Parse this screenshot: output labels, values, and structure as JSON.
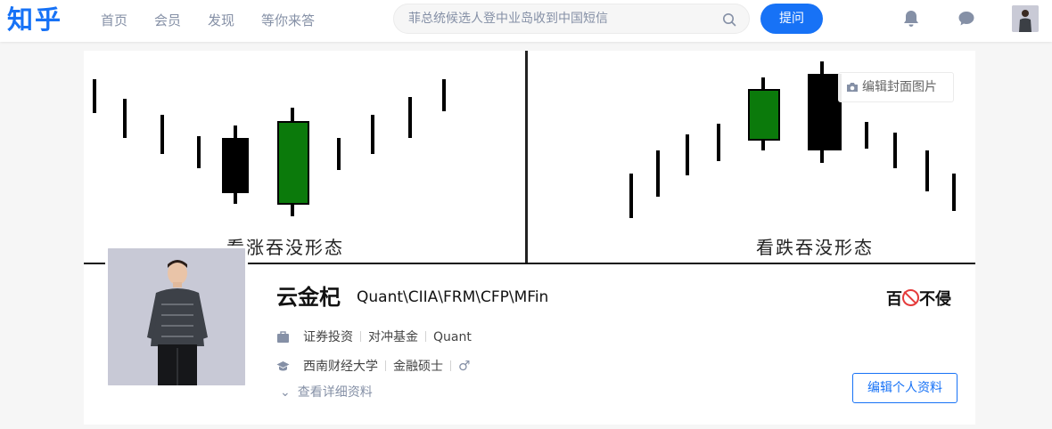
{
  "header": {
    "logo": "知乎",
    "nav": [
      "首页",
      "会员",
      "发现",
      "等你来答"
    ],
    "search_placeholder": "菲总统候选人登中业岛收到中国短信",
    "ask_label": "提问"
  },
  "cover": {
    "left_caption": "看涨吞没形态",
    "right_caption": "看跌吞没形态",
    "edit_cover_label": "编辑封面图片"
  },
  "profile": {
    "name": "云金杞",
    "headline": "Quant\\CIIA\\FRM\\CFP\\MFin",
    "industry": [
      "证券投资",
      "对冲基金",
      "Quant"
    ],
    "education": [
      "西南财经大学",
      "金融硕士"
    ],
    "gender_symbol": "♂",
    "more_detail": "查看详细资料",
    "edit_profile_label": "编辑个人资料",
    "badge_text": "百不侵"
  },
  "colors": {
    "brand": "#1772f6",
    "bull_candle": "#0b7a0b",
    "bear_candle": "#000000"
  }
}
